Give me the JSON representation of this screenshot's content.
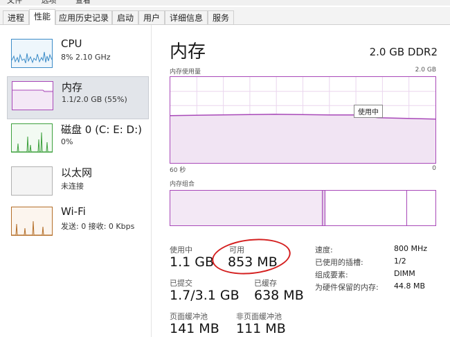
{
  "menu": {
    "file": "文件",
    "options": "选项",
    "view": "查看"
  },
  "tabs": [
    "进程",
    "性能",
    "应用历史记录",
    "启动",
    "用户",
    "详细信息",
    "服务"
  ],
  "sidebar": {
    "items": [
      {
        "name": "CPU",
        "sub": "8% 2.10 GHz",
        "color": "#3c8cc8"
      },
      {
        "name": "内存",
        "sub": "1.1/2.0 GB (55%)",
        "color": "#a848b8"
      },
      {
        "name": "磁盘 0 (C: E: D:)",
        "sub": "0%",
        "color": "#3ca03c"
      },
      {
        "name": "以太网",
        "sub": "未连接",
        "color": "#999999"
      },
      {
        "name": "Wi-Fi",
        "sub": "发送: 0 接收: 0 Kbps",
        "color": "#b46e28"
      }
    ]
  },
  "main": {
    "title": "内存",
    "spec": "2.0 GB DDR2",
    "usage_label": "内存使用量",
    "usage_max": "2.0 GB",
    "in_use_tooltip": "使用中",
    "time_left": "60 秒",
    "time_right": "0",
    "composition_label": "内存组合",
    "usage_fraction": 0.55
  },
  "stats": {
    "in_use": {
      "label": "使用中",
      "value": "1.1 GB"
    },
    "available": {
      "label": "可用",
      "value": "853 MB"
    },
    "committed": {
      "label": "已提交",
      "value": "1.7/3.1 GB"
    },
    "cached": {
      "label": "已缓存",
      "value": "638 MB"
    },
    "paged_pool": {
      "label": "页面缓冲池",
      "value": "141 MB"
    },
    "nonpaged_pool": {
      "label": "非页面缓冲池",
      "value": "111 MB"
    }
  },
  "props": {
    "speed": {
      "label": "速度:",
      "value": "800 MHz"
    },
    "slots": {
      "label": "已使用的插槽:",
      "value": "1/2"
    },
    "form": {
      "label": "组成要素:",
      "value": "DIMM"
    },
    "reserved": {
      "label": "为硬件保留的内存:",
      "value": "44.8 MB"
    }
  }
}
